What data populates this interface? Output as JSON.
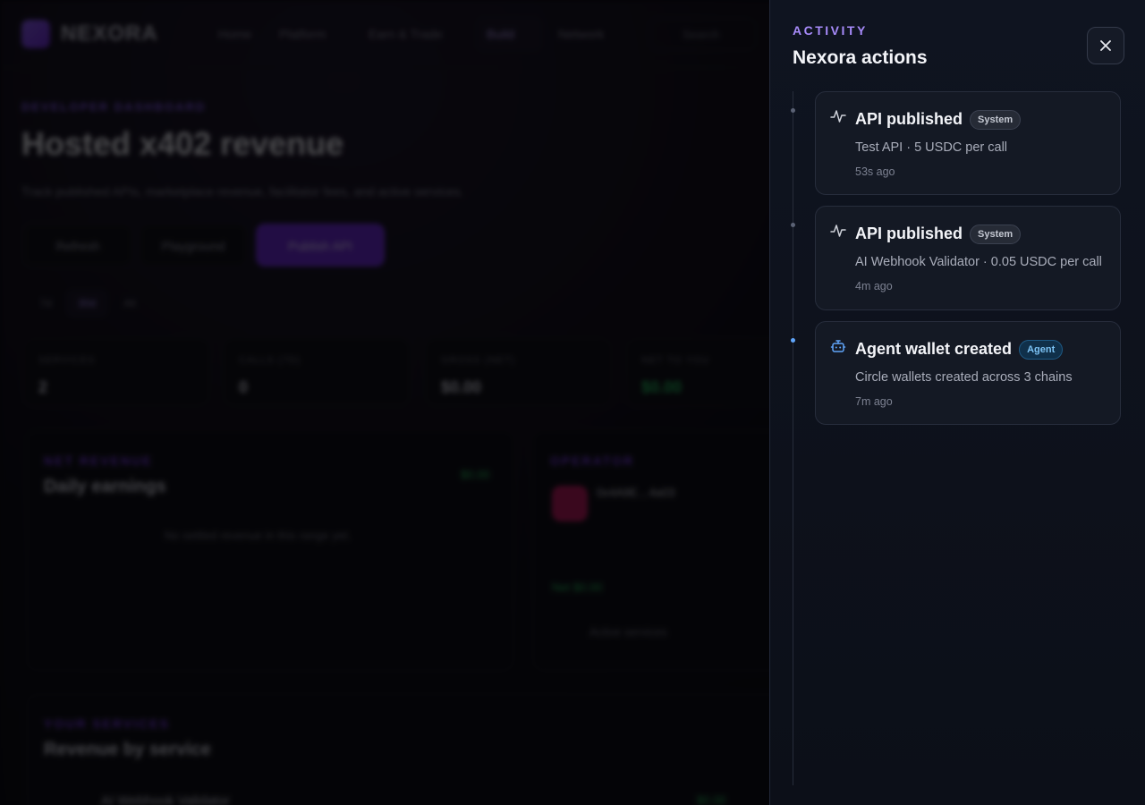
{
  "background": {
    "brand": "NEXORA",
    "nav": [
      "Home",
      "Platform",
      "Earn & Trade",
      "Build",
      "Network"
    ],
    "search_placeholder": "Search",
    "kicker": "DEVELOPER DASHBOARD",
    "title": "Hosted x402 revenue",
    "subtitle": "Track published APIs, marketplace revenue, facilitator fees, and active services.",
    "buttons": [
      "Refresh",
      "Playground",
      "Publish API"
    ],
    "ranges": [
      "7d",
      "30d",
      "All"
    ],
    "stats": [
      {
        "label": "SERVICES",
        "value": "2"
      },
      {
        "label": "CALLS (7D)",
        "value": "0"
      },
      {
        "label": "GROSS (NET)",
        "value": "$0.00"
      },
      {
        "label": "NET TO YOU",
        "value": "$0.00"
      }
    ],
    "revenue_panel": {
      "kicker": "NET REVENUE",
      "title": "Daily earnings",
      "empty": "No settled revenue in this range yet.",
      "total": "$0.00"
    },
    "operator_panel": {
      "kicker": "OPERATOR",
      "account": "0x4A9E…4a03",
      "net": "Net $0.00",
      "active": "Active services"
    },
    "services_panel": {
      "kicker": "YOUR SERVICES",
      "title": "Revenue by service",
      "row_name": "AI Webhook Validator",
      "row_value": "$0.00"
    }
  },
  "drawer": {
    "kicker": "ACTIVITY",
    "title": "Nexora actions",
    "close_icon": "close-icon",
    "items": [
      {
        "icon": "activity-icon",
        "title": "API published",
        "badge": "System",
        "badge_type": "system",
        "description": "Test API · 5 USDC per call",
        "time": "53s ago"
      },
      {
        "icon": "activity-icon",
        "title": "API published",
        "badge": "System",
        "badge_type": "system",
        "description": "AI Webhook Validator · 0.05 USDC per call",
        "time": "4m ago"
      },
      {
        "icon": "bot-icon",
        "title": "Agent wallet created",
        "badge": "Agent",
        "badge_type": "agent",
        "description": "Circle wallets created across 3 chains",
        "time": "7m ago"
      }
    ]
  },
  "colors": {
    "accent": "#a78bfa",
    "agent_badge": "#7cc3f5",
    "primary": "#6d28d9"
  }
}
